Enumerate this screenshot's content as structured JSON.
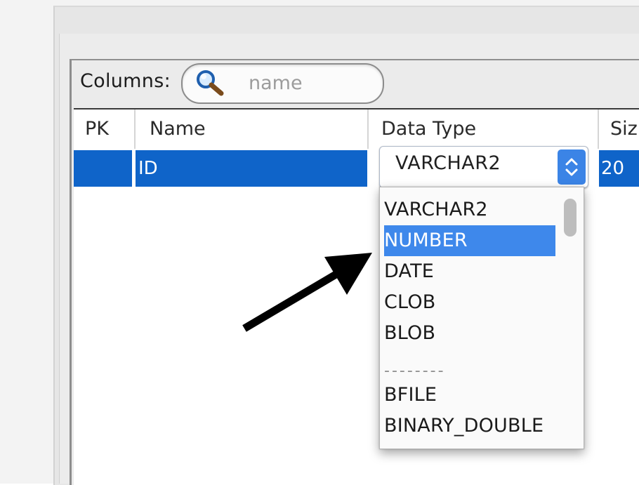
{
  "toolbar": {
    "columns_label": "Columns:",
    "search_placeholder": "name"
  },
  "table": {
    "headers": [
      "PK",
      "Name",
      "Data Type",
      "Siz"
    ],
    "rows": [
      {
        "pk": "",
        "name": "ID",
        "data_type": "VARCHAR2",
        "size": "20"
      }
    ]
  },
  "datatype_dropdown": {
    "selected": "VARCHAR2",
    "highlighted": "NUMBER",
    "options": [
      "VARCHAR2",
      "NUMBER",
      "DATE",
      "CLOB",
      "BLOB",
      "--------",
      "BFILE",
      "BINARY_DOUBLE"
    ]
  },
  "icons": {
    "search": "search-icon",
    "stepper": "up-down-stepper-icon",
    "pointer": "arrow-annotation-icon"
  },
  "colors": {
    "selection_row": "#0f64c9",
    "highlight_option": "#3e88eb",
    "stepper": "#3b84e6"
  }
}
